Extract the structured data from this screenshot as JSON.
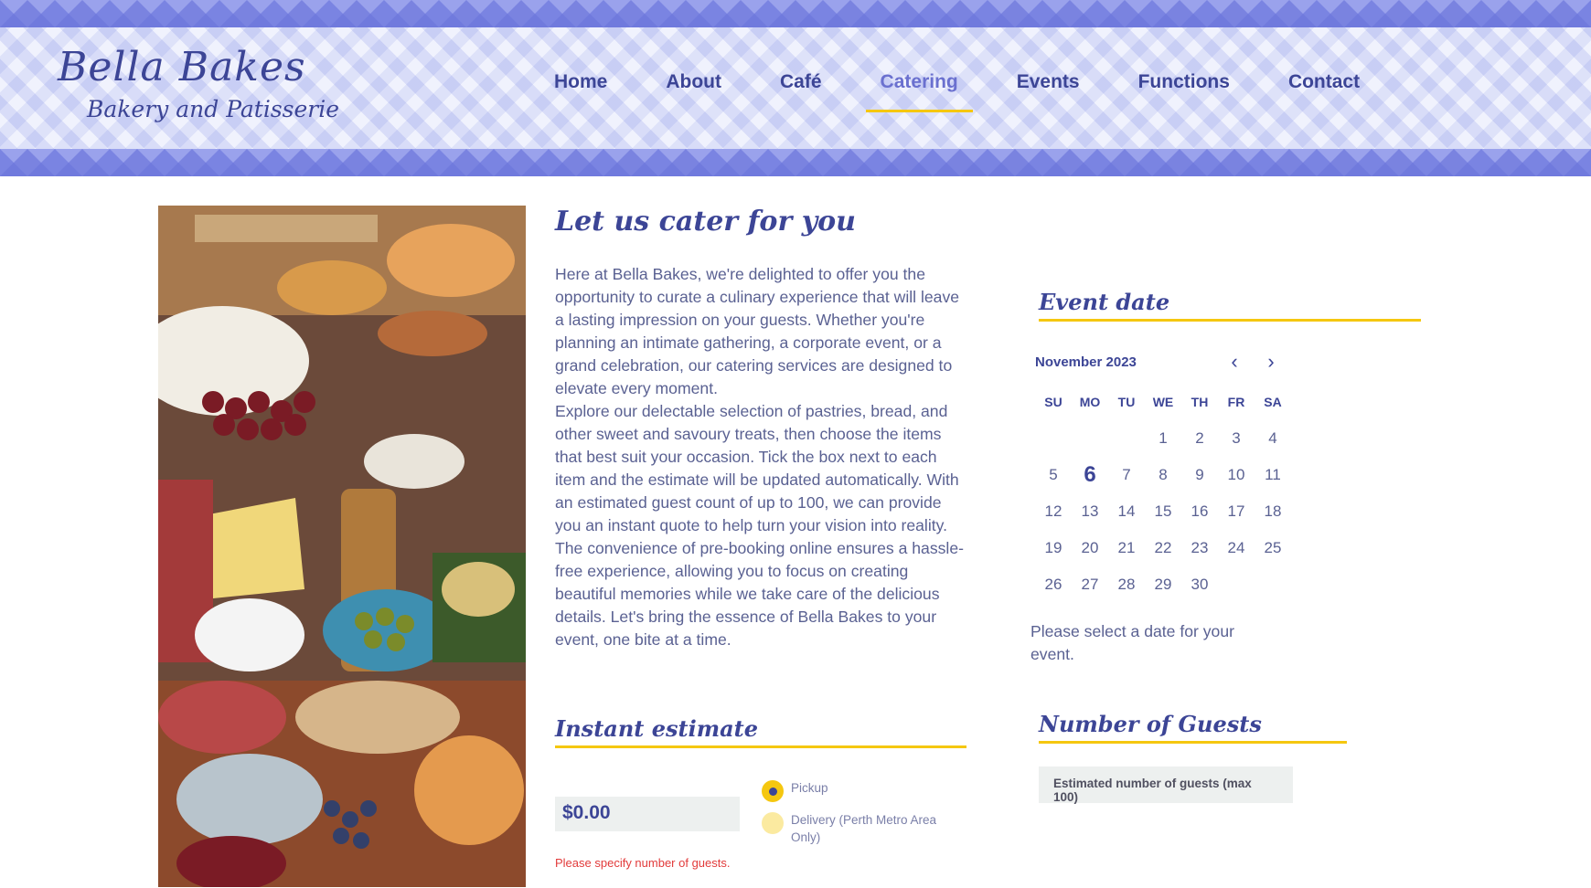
{
  "brand": {
    "name": "Bella Bakes",
    "tagline": "Bakery and Patisserie"
  },
  "nav": {
    "items": [
      {
        "label": "Home"
      },
      {
        "label": "About"
      },
      {
        "label": "Café"
      },
      {
        "label": "Catering"
      },
      {
        "label": "Events"
      },
      {
        "label": "Functions"
      },
      {
        "label": "Contact"
      }
    ],
    "active": "Catering"
  },
  "intro": {
    "title": "Let us cater for you",
    "paragraphs": [
      "Here at Bella Bakes, we're delighted to offer you the opportunity to curate a culinary experience that will leave a lasting impression on your guests. Whether you're planning an intimate gathering, a corporate event, or a grand celebration, our catering services are designed to elevate every moment.",
      "Explore our delectable selection of pastries, bread, and other sweet and savoury treats, then choose the items that best suit your occasion. Tick the box next to each item and the estimate will be updated automatically. With an estimated guest count of up to 100, we can provide you an instant quote to help turn your vision into reality.",
      "The convenience of pre-booking online ensures a hassle-free experience, allowing you to focus on creating beautiful memories while we take care of the delicious details. Let's bring the essence of Bella Bakes to your event, one bite at a time."
    ]
  },
  "estimate": {
    "title": "Instant estimate",
    "value": "$0.00",
    "error": "Please specify number of guests.",
    "options": [
      {
        "label": "Pickup",
        "checked": true
      },
      {
        "label": "Delivery (Perth Metro Area Only)",
        "checked": false
      }
    ]
  },
  "event_date": {
    "title": "Event date",
    "month": "November 2023",
    "weekdays": [
      "SU",
      "MO",
      "TU",
      "WE",
      "TH",
      "FR",
      "SA"
    ],
    "first_weekday_index": 3,
    "days_in_month": 30,
    "today": "6",
    "message": "Please select a date for your event."
  },
  "guests": {
    "title": "Number of Guests",
    "placeholder": "Estimated number of guests (max 100)"
  },
  "colors": {
    "primary": "#3c4596",
    "accent": "#f5c710",
    "active_nav": "#6a70cf",
    "error": "#e23b3b"
  }
}
